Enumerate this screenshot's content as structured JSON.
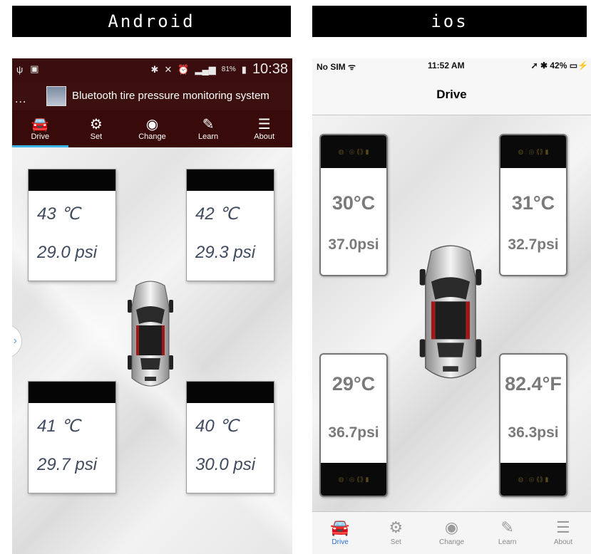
{
  "labels": {
    "android": "Android",
    "ios": "ios"
  },
  "android": {
    "status": {
      "time": "10:38",
      "battery": "81%"
    },
    "title_bar": {
      "dots": "...",
      "title": "Bluetooth tire pressure monitoring system"
    },
    "tabs": [
      {
        "label": "Drive",
        "icon": "car-icon",
        "glyph": "🚘"
      },
      {
        "label": "Set",
        "icon": "gear-icon",
        "glyph": "⚙"
      },
      {
        "label": "Change",
        "icon": "tire-icon",
        "glyph": "◉"
      },
      {
        "label": "Learn",
        "icon": "edit-icon",
        "glyph": "✎"
      },
      {
        "label": "About",
        "icon": "list-icon",
        "glyph": "☰"
      }
    ],
    "active_tab": "Drive",
    "tires": {
      "front_left": {
        "temp": "43 ℃",
        "pressure": "29.0 psi"
      },
      "front_right": {
        "temp": "42 ℃",
        "pressure": "29.3 psi"
      },
      "rear_left": {
        "temp": "41 ℃",
        "pressure": "29.7 psi"
      },
      "rear_right": {
        "temp": "40 ℃",
        "pressure": "30.0 psi"
      }
    },
    "drawer_handle": "›"
  },
  "ios": {
    "status": {
      "carrier": "No SIM ᯤ",
      "time": "11:52 AM",
      "right": "➚ ✱ 42% ▭⚡"
    },
    "nav_title": "Drive",
    "tires": {
      "front_left": {
        "temp": "30°C",
        "pressure": "37.0psi"
      },
      "front_right": {
        "temp": "31°C",
        "pressure": "32.7psi"
      },
      "rear_left": {
        "temp": "29°C",
        "pressure": "36.7psi"
      },
      "rear_right": {
        "temp": "82.4°F",
        "pressure": "36.3psi"
      }
    },
    "indicator_glyphs": "◍ ⫶ ◎ ⟪⟫ ▮",
    "tabs": [
      {
        "label": "Drive",
        "icon": "car-icon",
        "glyph": "🚘"
      },
      {
        "label": "Set",
        "icon": "gear-icon",
        "glyph": "⚙"
      },
      {
        "label": "Change",
        "icon": "tire-icon",
        "glyph": "◉"
      },
      {
        "label": "Learn",
        "icon": "edit-icon",
        "glyph": "✎"
      },
      {
        "label": "About",
        "icon": "list-icon",
        "glyph": "☰"
      }
    ],
    "active_tab": "Drive"
  },
  "colors": {
    "android_bar": "#3a0e0e",
    "android_accent": "#3ab3e8",
    "ios_accent": "#2a6fd6",
    "sensor_text_android": "#404b60",
    "sensor_text_ios": "#7a7a7a"
  }
}
